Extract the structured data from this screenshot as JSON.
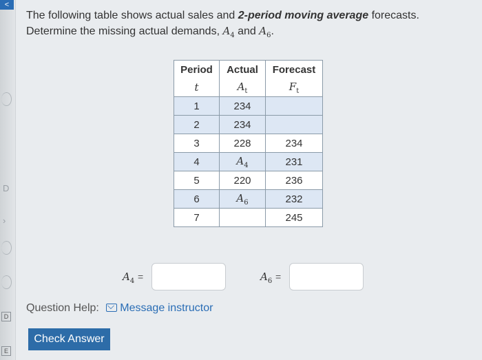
{
  "question": {
    "line1_pre": "The following table shows actual sales and ",
    "line1_bold": "2-period moving average",
    "line1_post": " forecasts.",
    "line2_pre": "Determine the missing actual demands, ",
    "var_a4": "A",
    "var_a4_sub": "4",
    "line2_and": " and ",
    "var_a6": "A",
    "var_a6_sub": "6",
    "line2_post": "."
  },
  "table": {
    "headers": [
      "Period",
      "Actual",
      "Forecast"
    ],
    "subheaders": [
      "t",
      "A",
      "F"
    ],
    "subheader_subs": [
      "",
      "t",
      "t"
    ],
    "rows": [
      {
        "period": "1",
        "actual": "234",
        "actual_sub": "",
        "forecast": ""
      },
      {
        "period": "2",
        "actual": "234",
        "actual_sub": "",
        "forecast": ""
      },
      {
        "period": "3",
        "actual": "228",
        "actual_sub": "",
        "forecast": "234"
      },
      {
        "period": "4",
        "actual": "A",
        "actual_sub": "4",
        "forecast": "231"
      },
      {
        "period": "5",
        "actual": "220",
        "actual_sub": "",
        "forecast": "236"
      },
      {
        "period": "6",
        "actual": "A",
        "actual_sub": "6",
        "forecast": "232"
      },
      {
        "period": "7",
        "actual": "",
        "actual_sub": "",
        "forecast": "245"
      }
    ]
  },
  "answers": [
    {
      "var": "A",
      "sub": "4",
      "eq": "=",
      "value": ""
    },
    {
      "var": "A",
      "sub": "6",
      "eq": "=",
      "value": ""
    }
  ],
  "help": {
    "label": "Question Help:",
    "link": "Message instructor"
  },
  "check_button": "Check Answer",
  "colors": {
    "accent": "#2d6ca8",
    "table_shade": "#dde7f4"
  }
}
